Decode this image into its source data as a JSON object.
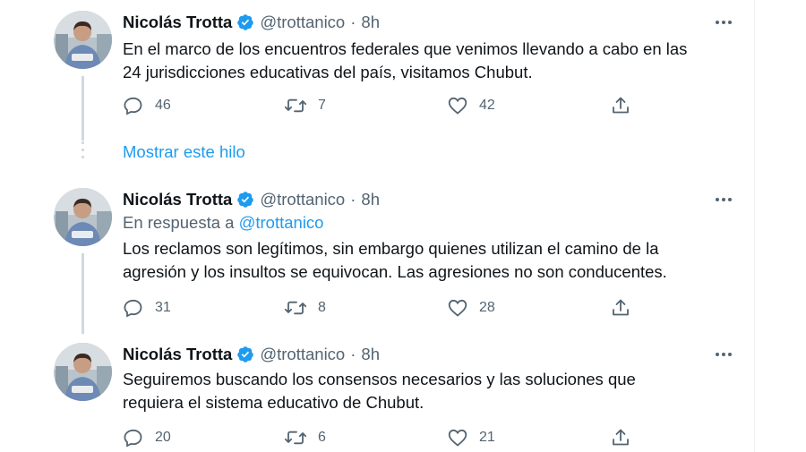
{
  "tweets": [
    {
      "author_name": "Nicolás Trotta",
      "handle": "@trottanico",
      "separator": "·",
      "time": "8h",
      "reply_prefix": "",
      "reply_handle": "",
      "text": "En el marco de los encuentros federales que venimos llevando a cabo en las\n24 jurisdicciones educativas del país, visitamos Chubut.",
      "replies": "46",
      "retweets": "7",
      "likes": "42"
    },
    {
      "author_name": "Nicolás Trotta",
      "handle": "@trottanico",
      "separator": "·",
      "time": "8h",
      "reply_prefix": "En respuesta a",
      "reply_handle": "@trottanico",
      "text": "Los reclamos son legítimos, sin embargo quienes utilizan el camino de la\nagresión y los insultos se equivocan. Las agresiones no son conducentes.",
      "replies": "31",
      "retweets": "8",
      "likes": "28"
    },
    {
      "author_name": "Nicolás Trotta",
      "handle": "@trottanico",
      "separator": "·",
      "time": "8h",
      "reply_prefix": "",
      "reply_handle": "",
      "text": "Seguiremos buscando los consensos necesarios y las soluciones que\nrequiera el sistema educativo de Chubut.",
      "replies": "20",
      "retweets": "6",
      "likes": "21"
    }
  ],
  "show_thread": {
    "label": "Mostrar este hilo"
  },
  "icons": {
    "verified": "verified-badge-icon",
    "more": "more-horizontal-icon",
    "reply": "reply-bubble-icon",
    "retweet": "retweet-icon",
    "like": "heart-icon",
    "share": "share-icon"
  },
  "colors": {
    "accent": "#1d9bf0",
    "text_primary": "#0f1419",
    "text_secondary": "#536471",
    "thread_line": "#cfd9de"
  }
}
